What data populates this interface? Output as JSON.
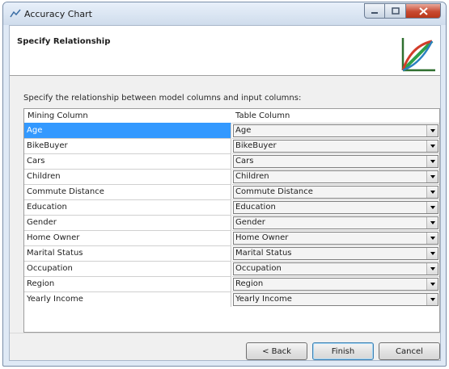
{
  "window": {
    "title": "Accuracy Chart"
  },
  "header": {
    "title": "Specify Relationship"
  },
  "instruction": "Specify the relationship between model columns and input columns:",
  "columns": {
    "mining": "Mining Column",
    "table": "Table Column"
  },
  "rows": [
    {
      "mining": "Age",
      "table": "Age"
    },
    {
      "mining": "BikeBuyer",
      "table": "BikeBuyer"
    },
    {
      "mining": "Cars",
      "table": "Cars"
    },
    {
      "mining": "Children",
      "table": "Children"
    },
    {
      "mining": "Commute Distance",
      "table": "Commute Distance"
    },
    {
      "mining": "Education",
      "table": "Education"
    },
    {
      "mining": "Gender",
      "table": "Gender"
    },
    {
      "mining": "Home Owner",
      "table": "Home Owner"
    },
    {
      "mining": "Marital Status",
      "table": "Marital Status"
    },
    {
      "mining": "Occupation",
      "table": "Occupation"
    },
    {
      "mining": "Region",
      "table": "Region"
    },
    {
      "mining": "Yearly Income",
      "table": "Yearly Income"
    }
  ],
  "selected_row": "Age",
  "buttons": {
    "back": "< Back",
    "finish": "Finish",
    "cancel": "Cancel"
  },
  "icons": {
    "app": "chart-icon",
    "header": "accuracy-chart-logo"
  },
  "colors": {
    "selection": "#3399ff",
    "close": "#c84a31",
    "window_frame": "#dfe9f5"
  }
}
